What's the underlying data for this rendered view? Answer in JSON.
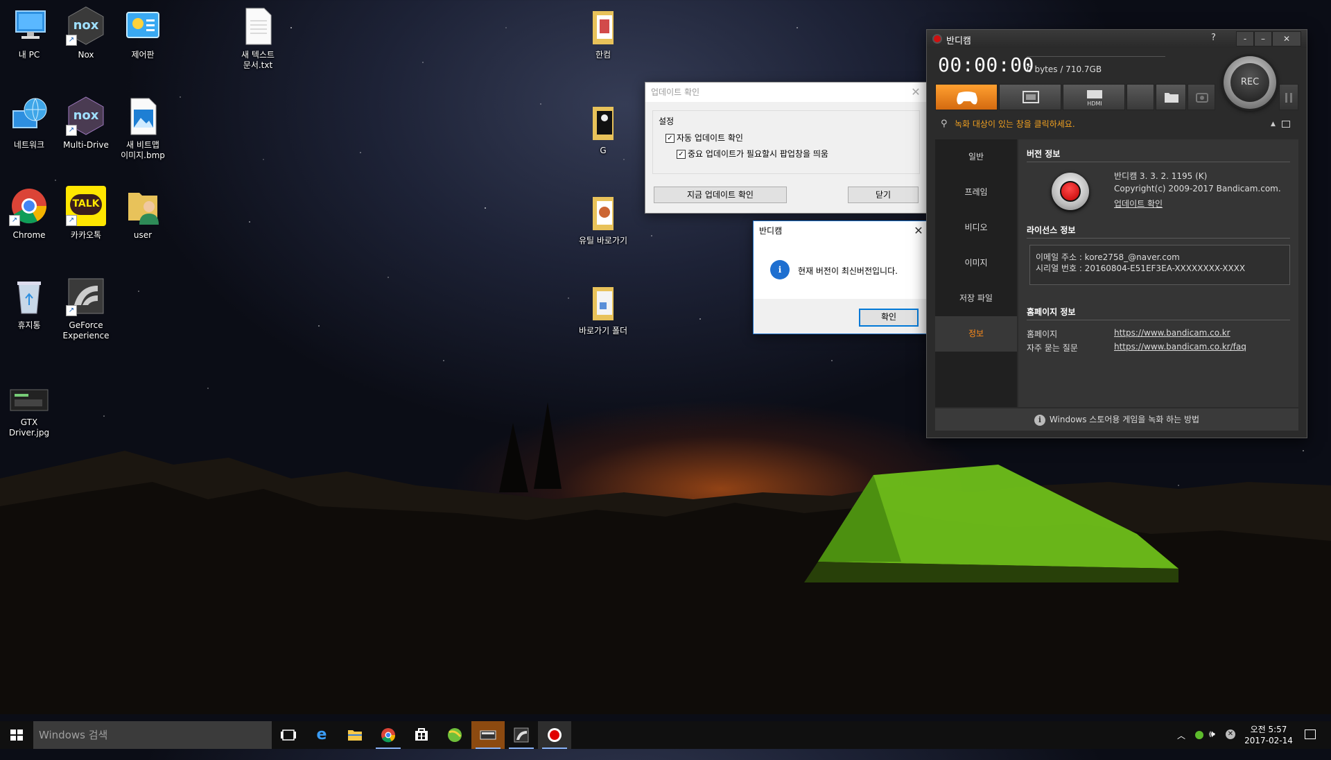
{
  "desktop": {
    "icons": [
      {
        "label": "내 PC"
      },
      {
        "label": "Nox"
      },
      {
        "label": "제어판"
      },
      {
        "label": "새 텍스트\n문서.txt"
      },
      {
        "label": "네트워크"
      },
      {
        "label": "Multi-Drive"
      },
      {
        "label": "새 비트맵\n이미지.bmp"
      },
      {
        "label": "Chrome"
      },
      {
        "label": "카카오톡"
      },
      {
        "label": "user"
      },
      {
        "label": "휴지통"
      },
      {
        "label": "GeForce\nExperience"
      },
      {
        "label": "GTX Driver.jpg"
      },
      {
        "label": "한컴"
      },
      {
        "label": "G"
      },
      {
        "label": "유틸 바로가기"
      },
      {
        "label": "바로가기 폴더"
      }
    ],
    "kakao_logo_text": "TALK",
    "nox_logo_text": "nox"
  },
  "update_dialog": {
    "title": "업데이트 확인",
    "group_label": "설정",
    "auto_update_label": "자동 업데이트 확인",
    "auto_update_checked": true,
    "popup_label": "중요 업데이트가 필요할시 팝업창을 띄움",
    "popup_checked": true,
    "check_now_button": "지금 업데이트 확인",
    "close_button": "닫기"
  },
  "message_dialog": {
    "title": "반디캠",
    "message": "현재 버전이 최신버전입니다.",
    "ok_button": "확인"
  },
  "bandicam": {
    "title": "반디캠",
    "help": "?",
    "timer": "00:00:00",
    "size": "0 bytes / 710.7GB",
    "rec_label": "REC",
    "hdmi_label": "HDMI",
    "search_hint": "녹화 대상이 있는 창을 클릭하세요.",
    "nav": [
      {
        "label": "일반"
      },
      {
        "label": "프레임"
      },
      {
        "label": "비디오"
      },
      {
        "label": "이미지"
      },
      {
        "label": "저장 파일"
      },
      {
        "label": "정보"
      }
    ],
    "version_section": "버전 정보",
    "version": "반디캠 3. 3. 2. 1195 (K)",
    "copyright": "Copyright(c) 2009-2017 Bandicam.com.",
    "update_link": "업데이트 확인",
    "license_section": "라이선스 정보",
    "email_line": "이메일 주소 : kore2758_@naver.com",
    "serial_line": "시리얼 번호 : 20160804-E51EF3EA-XXXXXXXX-XXXX",
    "homepage_section": "홈페이지 정보",
    "homepage_label": "홈페이지",
    "homepage_url": "https://www.bandicam.co.kr",
    "faq_label": "자주 묻는 질문",
    "faq_url": "https://www.bandicam.co.kr/faq",
    "footer": "Windows 스토어용 게임을 녹화 하는 방법"
  },
  "taskbar": {
    "search_placeholder": "Windows 검색",
    "time": "오전 5:57",
    "date": "2017-02-14"
  }
}
